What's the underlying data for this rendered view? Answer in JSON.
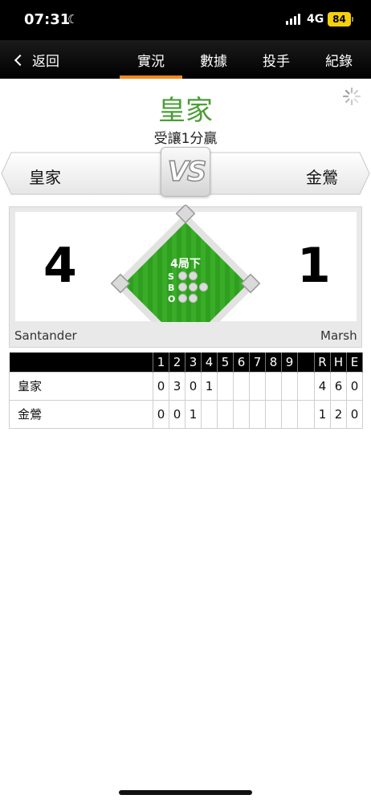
{
  "status_bar": {
    "time": "07:31",
    "network": "4G",
    "battery": "84"
  },
  "nav": {
    "back_label": "返回",
    "tabs": [
      {
        "label": "實況",
        "active": true
      },
      {
        "label": "數據",
        "active": false
      },
      {
        "label": "投手",
        "active": false
      },
      {
        "label": "紀錄",
        "active": false
      }
    ]
  },
  "header": {
    "team_title": "皇家",
    "spread": "受讓1分贏"
  },
  "matchup": {
    "away_team": "皇家",
    "home_team": "金鶯",
    "vs_label": "VS"
  },
  "game": {
    "away_score": "4",
    "home_score": "1",
    "inning": "4局下",
    "count_labels": [
      "S",
      "B",
      "O"
    ],
    "strikes": 0,
    "balls": 0,
    "outs": 0,
    "away_pitcher": "Santander",
    "home_pitcher": "Marsh"
  },
  "linescore": {
    "headers": [
      "",
      "1",
      "2",
      "3",
      "4",
      "5",
      "6",
      "7",
      "8",
      "9",
      "",
      "R",
      "H",
      "E"
    ],
    "rows": [
      [
        "皇家",
        "0",
        "3",
        "0",
        "1",
        "",
        "",
        "",
        "",
        "",
        "",
        "4",
        "6",
        "0"
      ],
      [
        "金鶯",
        "0",
        "0",
        "1",
        "",
        "",
        "",
        "",
        "",
        "",
        "",
        "1",
        "2",
        "0"
      ]
    ]
  },
  "colors": {
    "accent": "#f08a16",
    "team_green": "#4b9e38",
    "field_green": "#2f9f1f"
  }
}
